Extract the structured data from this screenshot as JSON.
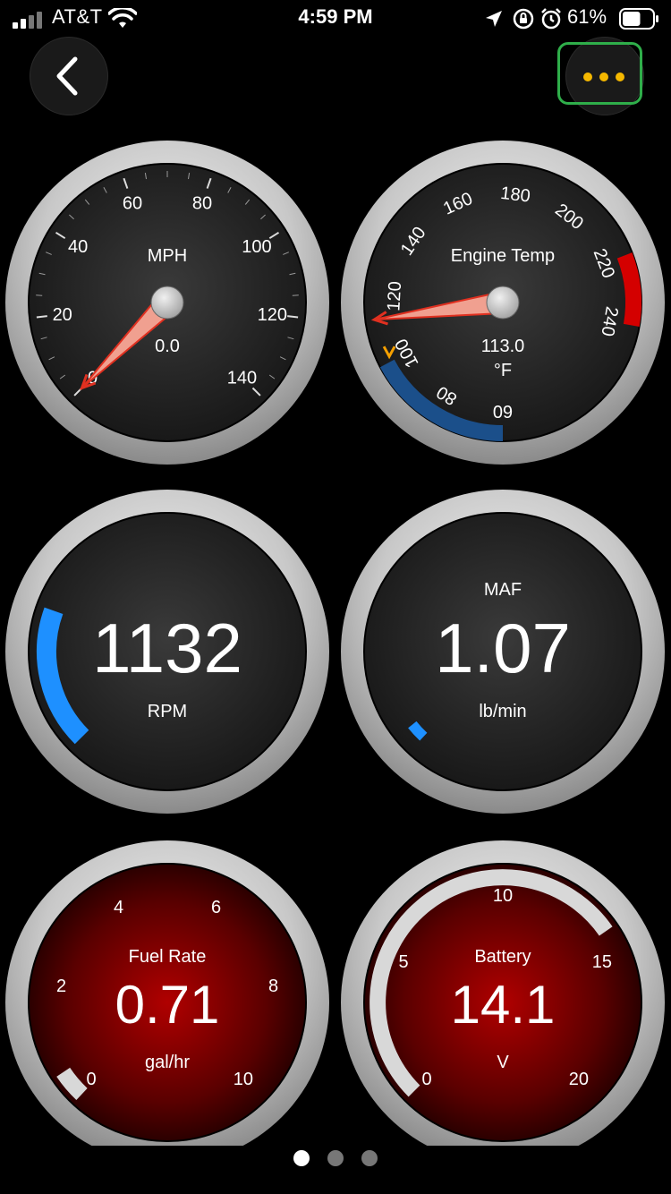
{
  "status_bar": {
    "carrier": "AT&T",
    "time": "4:59 PM",
    "battery_percent": "61%",
    "battery_level": 0.61
  },
  "nav": {
    "back_icon": "chevron-left-icon",
    "more_icon": "ellipsis-icon"
  },
  "gauges": {
    "speed": {
      "label": "MPH",
      "value": "0.0",
      "ticks": [
        "0",
        "20",
        "40",
        "60",
        "80",
        "100",
        "120",
        "140"
      ],
      "min": 0,
      "max": 140,
      "reading": 0
    },
    "engine_temp": {
      "label": "Engine Temp",
      "value": "113.0",
      "unit": "°F",
      "ticks": [
        "60",
        "80",
        "100",
        "120",
        "140",
        "160",
        "180",
        "200",
        "220",
        "240"
      ],
      "min": 60,
      "max": 240,
      "reading": 113
    },
    "rpm": {
      "label": "RPM",
      "value": "1132",
      "fill_fraction": 0.16
    },
    "maf": {
      "label": "MAF",
      "value": "1.07",
      "unit": "lb/min",
      "fill_fraction": 0.03
    },
    "fuel_rate": {
      "label": "Fuel Rate",
      "value": "0.71",
      "unit": "gal/hr",
      "ticks": [
        "0",
        "2",
        "4",
        "6",
        "8",
        "10"
      ],
      "min": 0,
      "max": 10,
      "reading": 0.71
    },
    "battery": {
      "label": "Battery",
      "value": "14.1",
      "unit": "V",
      "ticks": [
        "0",
        "5",
        "10",
        "15",
        "20"
      ],
      "min": 0,
      "max": 20,
      "reading": 14.1
    }
  },
  "pager": {
    "pages": 3,
    "active": 0
  },
  "colors": {
    "accent_blue": "#1e90ff",
    "needle_red": "#e03020",
    "redline": "#d40000",
    "cold_zone": "#1b4f8a",
    "warn_orange": "#f5a000",
    "highlight_green": "#2fae4a",
    "more_dots": "#f5b800"
  }
}
